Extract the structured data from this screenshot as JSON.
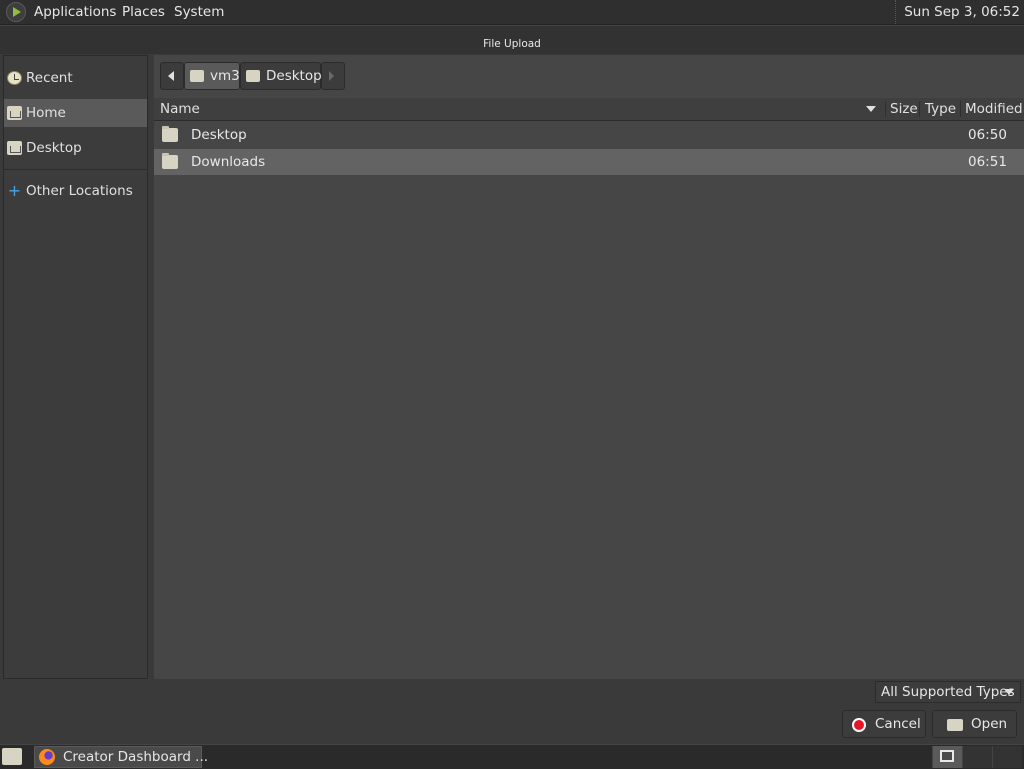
{
  "top_panel": {
    "menus": [
      "Applications",
      "Places",
      "System"
    ],
    "clock": "Sun Sep  3, 06:52"
  },
  "dialog": {
    "title": "File Upload"
  },
  "sidebar": {
    "items": [
      {
        "label": "Recent",
        "icon": "clock-icon"
      },
      {
        "label": "Home",
        "icon": "home-folder-icon",
        "selected": true
      },
      {
        "label": "Desktop",
        "icon": "desktop-folder-icon"
      },
      {
        "label": "Other Locations",
        "icon": "plus-icon"
      }
    ]
  },
  "pathbar": {
    "segments": [
      "vm3",
      "Desktop"
    ],
    "active": "vm3"
  },
  "file_list": {
    "columns": [
      "Name",
      "Size",
      "Type",
      "Modified"
    ],
    "rows": [
      {
        "name": "Desktop",
        "size": "",
        "type": "",
        "modified": "06:50"
      },
      {
        "name": "Downloads",
        "size": "",
        "type": "",
        "modified": "06:51",
        "selected": true
      }
    ]
  },
  "filter": {
    "selected": "All Supported Types"
  },
  "buttons": {
    "cancel": "Cancel",
    "open": "Open"
  },
  "taskbar": {
    "task_label": "Creator Dashboard ..."
  }
}
